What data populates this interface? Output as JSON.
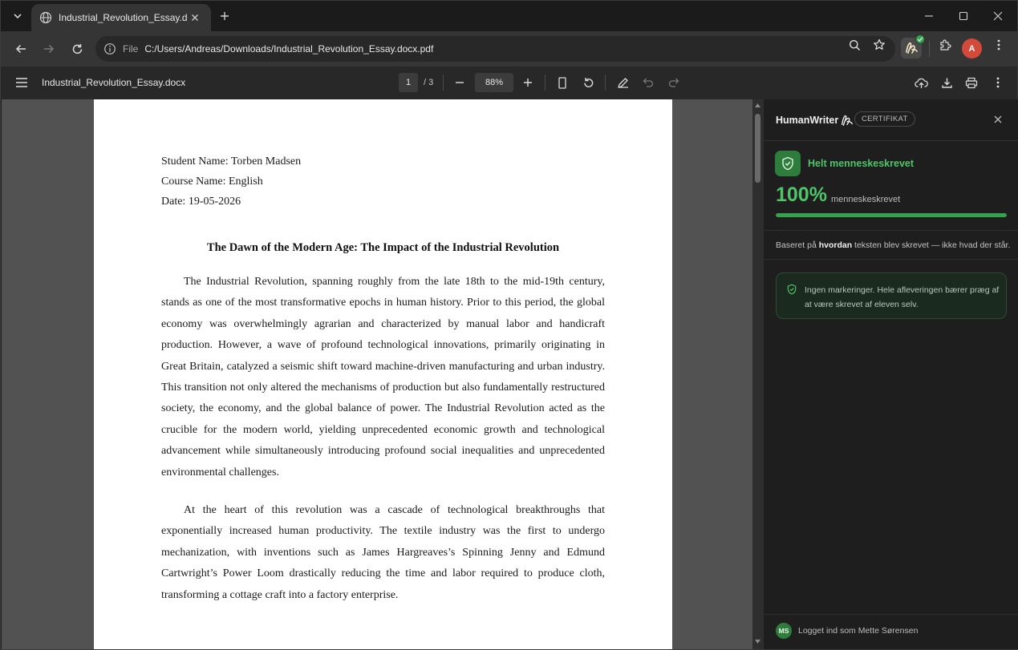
{
  "browser": {
    "tab_title": "Industrial_Revolution_Essay.docx...",
    "address_scheme": "File",
    "address_url": "C:/Users/Andreas/Downloads/Industrial_Revolution_Essay.docx.pdf",
    "profile_initial": "A"
  },
  "pdf_toolbar": {
    "doc_name": "Industrial_Revolution_Essay.docx",
    "current_page": "1",
    "page_total": "/ 3",
    "zoom": "88%"
  },
  "document": {
    "student": "Student Name: Torben Madsen",
    "course": "Course Name: English",
    "date": "Date: 19-05-2026",
    "title": "The Dawn of the Modern Age: The Impact of the Industrial Revolution",
    "paragraphs": [
      "The Industrial Revolution, spanning roughly from the late 18th to the mid-19th century, stands as one of the most transformative epochs in human history. Prior to this period, the global economy was overwhelmingly agrarian and characterized by manual labor and handicraft production. However, a wave of profound technological innovations, primarily originating in Great Britain, catalyzed a seismic shift toward machine-driven manufacturing and urban industry. This transition not only altered the mechanisms of production but also fundamentally restructured society, the economy, and the global balance of power. The Industrial Revolution acted as the crucible for the modern world, yielding unprecedented economic growth and technological advancement while simultaneously introducing profound social inequalities and unprecedented environmental challenges.",
      "At the heart of this revolution was a cascade of technological breakthroughs that exponentially increased human productivity. The textile industry was the first to undergo mechanization, with inventions such as James Hargreaves’s Spinning Jenny and Edmund Cartwright’s Power Loom drastically reducing the time and labor required to produce cloth, transforming a cottage craft into a factory enterprise."
    ]
  },
  "panel": {
    "brand": "HumanWriter",
    "badge": "CERTIFIKAT",
    "verdict": "Helt menneskeskrevet",
    "percent": "100%",
    "percent_label": "menneskeskrevet",
    "percent_value": 1.0,
    "basis_prefix": "Baseret på ",
    "basis_bold": "hvordan",
    "basis_suffix": " teksten blev skrevet — ikke hvad der står.",
    "note": "Ingen markeringer. Hele afleveringen bærer præg af at være skrevet af eleven selv.",
    "user_initials": "MS",
    "logged_in": "Logget ind som Mette Sørensen"
  },
  "colors": {
    "accent_green": "#4fc46a",
    "avatar_red": "#d34a3b"
  }
}
